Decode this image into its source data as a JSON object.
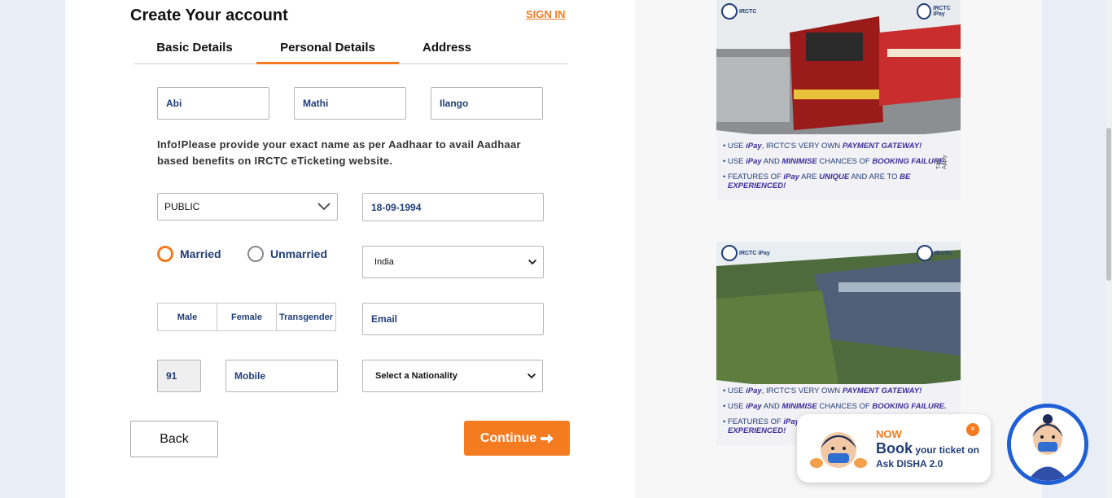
{
  "header": {
    "title": "Create Your account",
    "signin_label": "SIGN IN"
  },
  "tabs": [
    {
      "label": "Basic Details",
      "active": false
    },
    {
      "label": "Personal Details",
      "active": true
    },
    {
      "label": "Address",
      "active": false
    }
  ],
  "name": {
    "first": "Abi",
    "middle": "Mathi",
    "last": "Ilango"
  },
  "info_text": "Info!Please provide your exact name as per Aadhaar to avail Aadhaar based benefits on IRCTC eTicketing website.",
  "occupation": {
    "value": "PUBLIC"
  },
  "dob": {
    "value": "18-09-1994"
  },
  "marital": {
    "options": [
      "Married",
      "Unmarried"
    ],
    "selected": "Married"
  },
  "country": {
    "value": "India"
  },
  "gender": {
    "options": [
      "Male",
      "Female",
      "Transgender"
    ]
  },
  "email": {
    "placeholder": "Email"
  },
  "phone": {
    "isd": "91",
    "mobile_placeholder": "Mobile"
  },
  "nationality": {
    "value": "Select a Nationality"
  },
  "buttons": {
    "back": "Back",
    "continue": "Continue"
  },
  "ads": {
    "top": {
      "logo_left": "IRCTC",
      "logo_right": "IRCTC iPay",
      "lines": [
        {
          "pre": "• USE ",
          "em1": "iPay",
          "mid": ", IRCTC'S VERY OWN ",
          "em2": "PAYMENT GATEWAY!"
        },
        {
          "pre": "• USE ",
          "em1": "iPay",
          "mid": " AND ",
          "em2": "MINIMISE",
          "post": " CHANCES OF ",
          "em3": "BOOKING FAILURE."
        },
        {
          "pre": "• FEATURES OF ",
          "em1": "iPay",
          "mid": " ARE ",
          "em2": "UNIQUE",
          "post": " AND ARE TO ",
          "em3": "BE"
        },
        {
          "em1": "EXPERIENCED!"
        }
      ],
      "side_note": "T&C Apply"
    },
    "bottom": {
      "logo_left": "IRCTC iPay",
      "logo_right": "IRCTC",
      "lines": [
        {
          "pre": "• USE ",
          "em1": "iPay",
          "mid": ", IRCTC'S VERY OWN ",
          "em2": "PAYMENT GATEWAY!"
        },
        {
          "pre": "• USE ",
          "em1": "iPay",
          "mid": " AND ",
          "em2": "MINIMISE",
          "post": " CHANCES OF ",
          "em3": "BOOKING FAILURE."
        },
        {
          "pre": "• FEATURES OF ",
          "em1": "iPay"
        },
        {
          "em1": "EXPERIENCED!"
        }
      ]
    }
  },
  "disha": {
    "now": "NOW",
    "book": "Book",
    "book_rest": " your ticket on",
    "sub": "Ask DISHA 2.0",
    "close": "×"
  },
  "colors": {
    "accent": "#f47b20",
    "navy": "#213d77",
    "disha_ring": "#1f5fd6"
  }
}
